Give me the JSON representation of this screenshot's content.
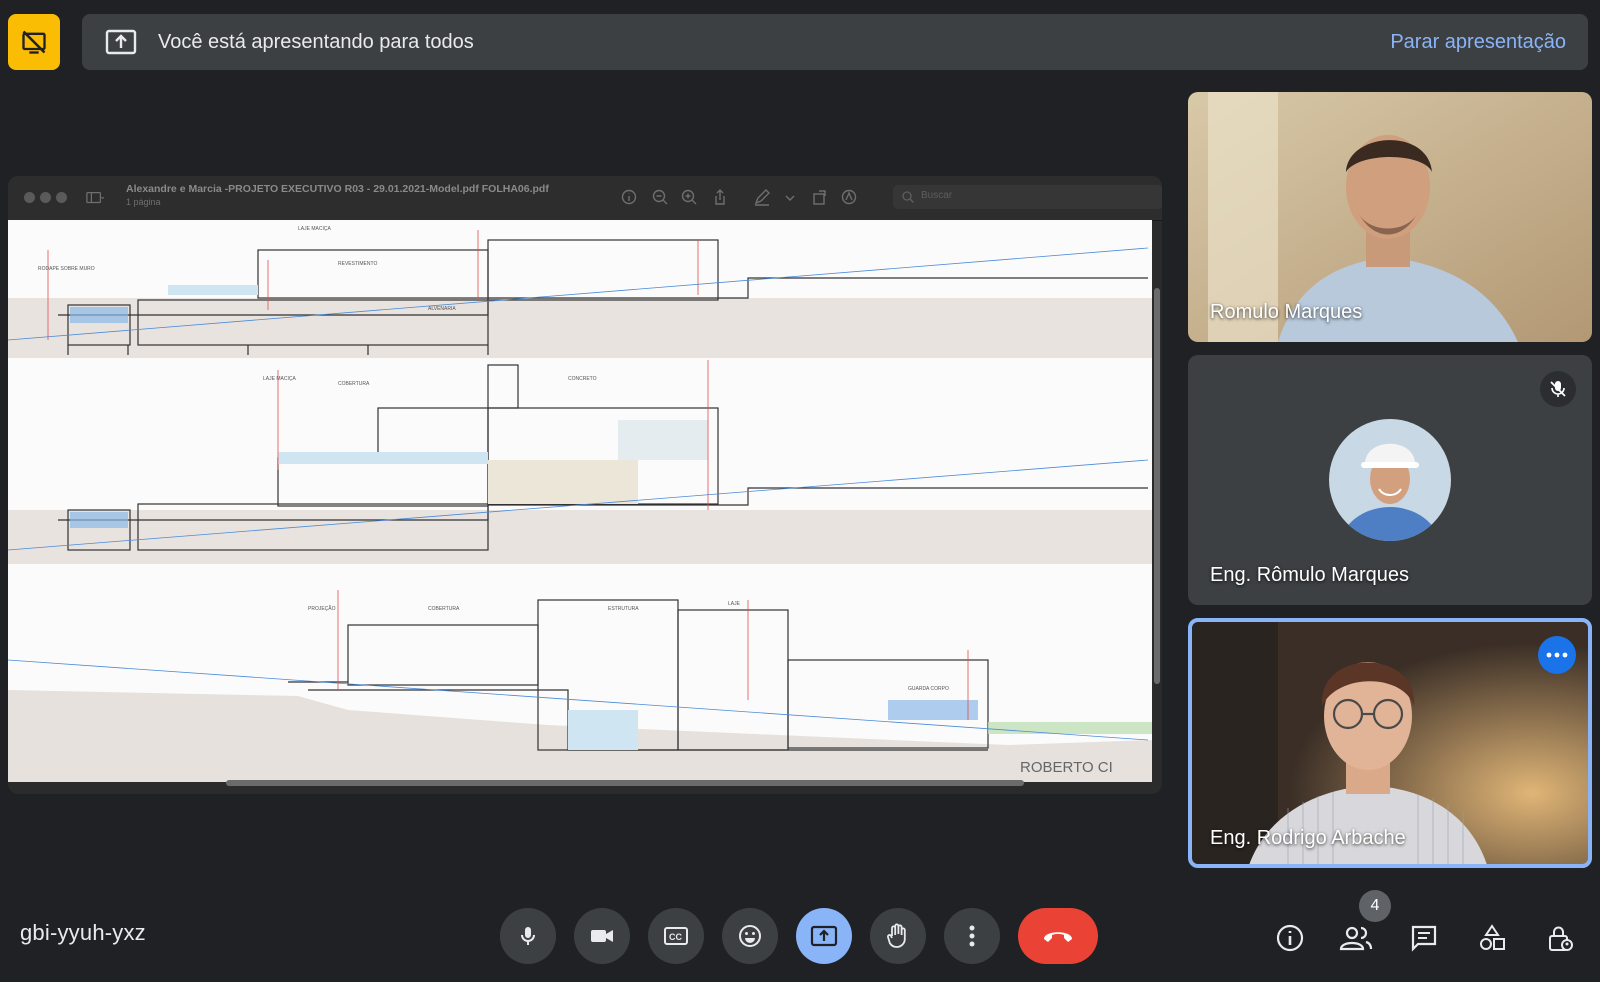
{
  "banner": {
    "message": "Você está apresentando para todos",
    "stop_label": "Parar apresentação",
    "indicator_icon": "present-off-icon",
    "present_icon": "present-to-all-icon",
    "accent_color": "#fbbc04",
    "link_color": "#8ab4f8"
  },
  "presentation": {
    "pdf_title": "Alexandre e Marcia -PROJETO EXECUTIVO R03  - 29.01.2021-Model.pdf FOLHA06.pdf",
    "pdf_pages": "1 página",
    "search_placeholder": "Buscar",
    "sheet_label": "ROBERTO CI"
  },
  "participants": [
    {
      "name": "Romulo Marques",
      "type": "video"
    },
    {
      "name": "Eng. Rômulo Marques",
      "type": "avatar",
      "muted": true
    },
    {
      "name": "Eng. Rodrigo Arbache",
      "type": "video",
      "active": true
    }
  ],
  "bottom_bar": {
    "meeting_code": "gbi-yyuh-yxz",
    "controls": [
      "microphone-icon",
      "camera-icon",
      "captions-icon",
      "emoji-icon",
      "present-icon",
      "raise-hand-icon",
      "more-options-icon",
      "hang-up-icon"
    ],
    "people_count": "4",
    "right_controls": [
      "info-icon",
      "people-icon",
      "chat-icon",
      "activities-icon",
      "host-controls-icon"
    ],
    "hangup_color": "#ea4335"
  }
}
